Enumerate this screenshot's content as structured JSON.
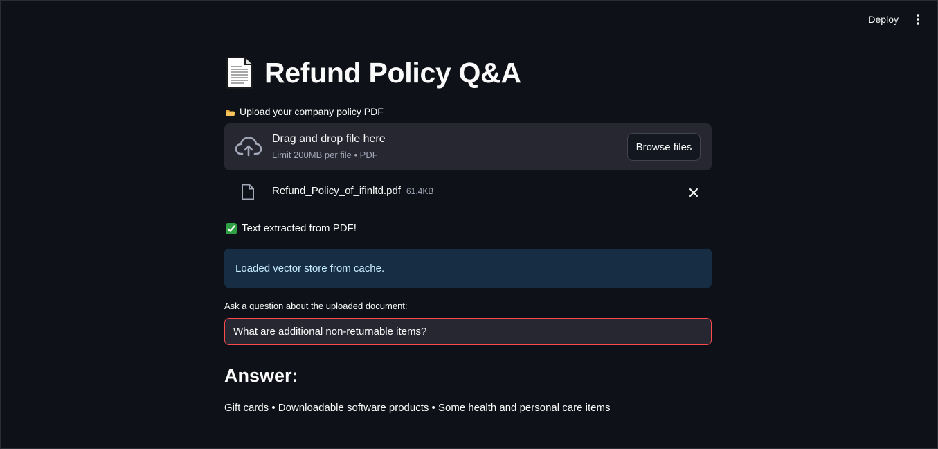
{
  "toolbar": {
    "deploy_label": "Deploy",
    "menu_icon": "vertical-ellipsis-icon"
  },
  "header": {
    "emoji_icon": "page-facing-up-icon",
    "title": "Refund Policy Q&A"
  },
  "uploader": {
    "label_icon": "open-folder-icon",
    "label": "Upload your company policy PDF",
    "dropzone_title": "Drag and drop file here",
    "dropzone_subtitle": "Limit 200MB per file • PDF",
    "browse_label": "Browse files",
    "upload_icon": "cloud-upload-icon"
  },
  "uploaded_file": {
    "name": "Refund_Policy_of_ifinltd.pdf",
    "size": "61.4KB",
    "icon": "file-icon",
    "remove_icon": "close-icon"
  },
  "status": {
    "success_icon": "check-mark-icon",
    "success_text": "Text extracted from PDF!",
    "info_text": "Loaded vector store from cache."
  },
  "question": {
    "label": "Ask a question about the uploaded document:",
    "value": "What are additional non-returnable items?"
  },
  "answer": {
    "heading": "Answer:",
    "text": "Gift cards • Downloadable software products • Some health and personal care items"
  },
  "colors": {
    "background": "#0e1117",
    "surface": "#262730",
    "info_bg": "#172d43",
    "info_text": "#c7ebff",
    "accent": "#ff4b4b",
    "success": "#2ea043"
  }
}
